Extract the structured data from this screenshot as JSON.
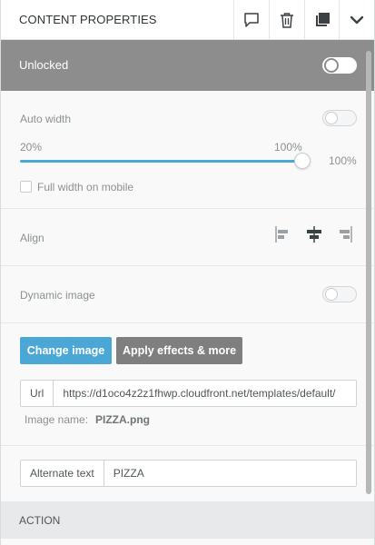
{
  "header": {
    "title": "CONTENT PROPERTIES",
    "icons": [
      "comment-icon",
      "trash-icon",
      "duplicate-icon",
      "chevron-down-icon"
    ]
  },
  "lock": {
    "label": "Unlocked",
    "enabled": false
  },
  "auto_width": {
    "label": "Auto width",
    "enabled": false
  },
  "width_slider": {
    "min_label": "20%",
    "max_label": "100%",
    "value_label": "100%",
    "value_percent": 100
  },
  "full_width_mobile": {
    "label": "Full width on mobile",
    "checked": false
  },
  "align": {
    "label": "Align",
    "options": [
      "align-left-icon",
      "align-center-icon",
      "align-right-icon"
    ],
    "selected": "center"
  },
  "dynamic_image": {
    "label": "Dynamic image",
    "enabled": false
  },
  "image_buttons": {
    "change_label": "Change image",
    "effects_label": "Apply effects & more"
  },
  "url": {
    "addon": "Url",
    "value": "https://d1oco4z2z1fhwp.cloudfront.net/templates/default/"
  },
  "image_name": {
    "label": "Image name:",
    "value": "PIZZA.png"
  },
  "alt_text": {
    "addon": "Alternate text",
    "value": "PIZZA"
  },
  "action": {
    "label": "ACTION"
  },
  "colors": {
    "accent": "#4aa7d6",
    "lock_band": "#8d8d8d",
    "grey_button": "#7f7f7f"
  }
}
